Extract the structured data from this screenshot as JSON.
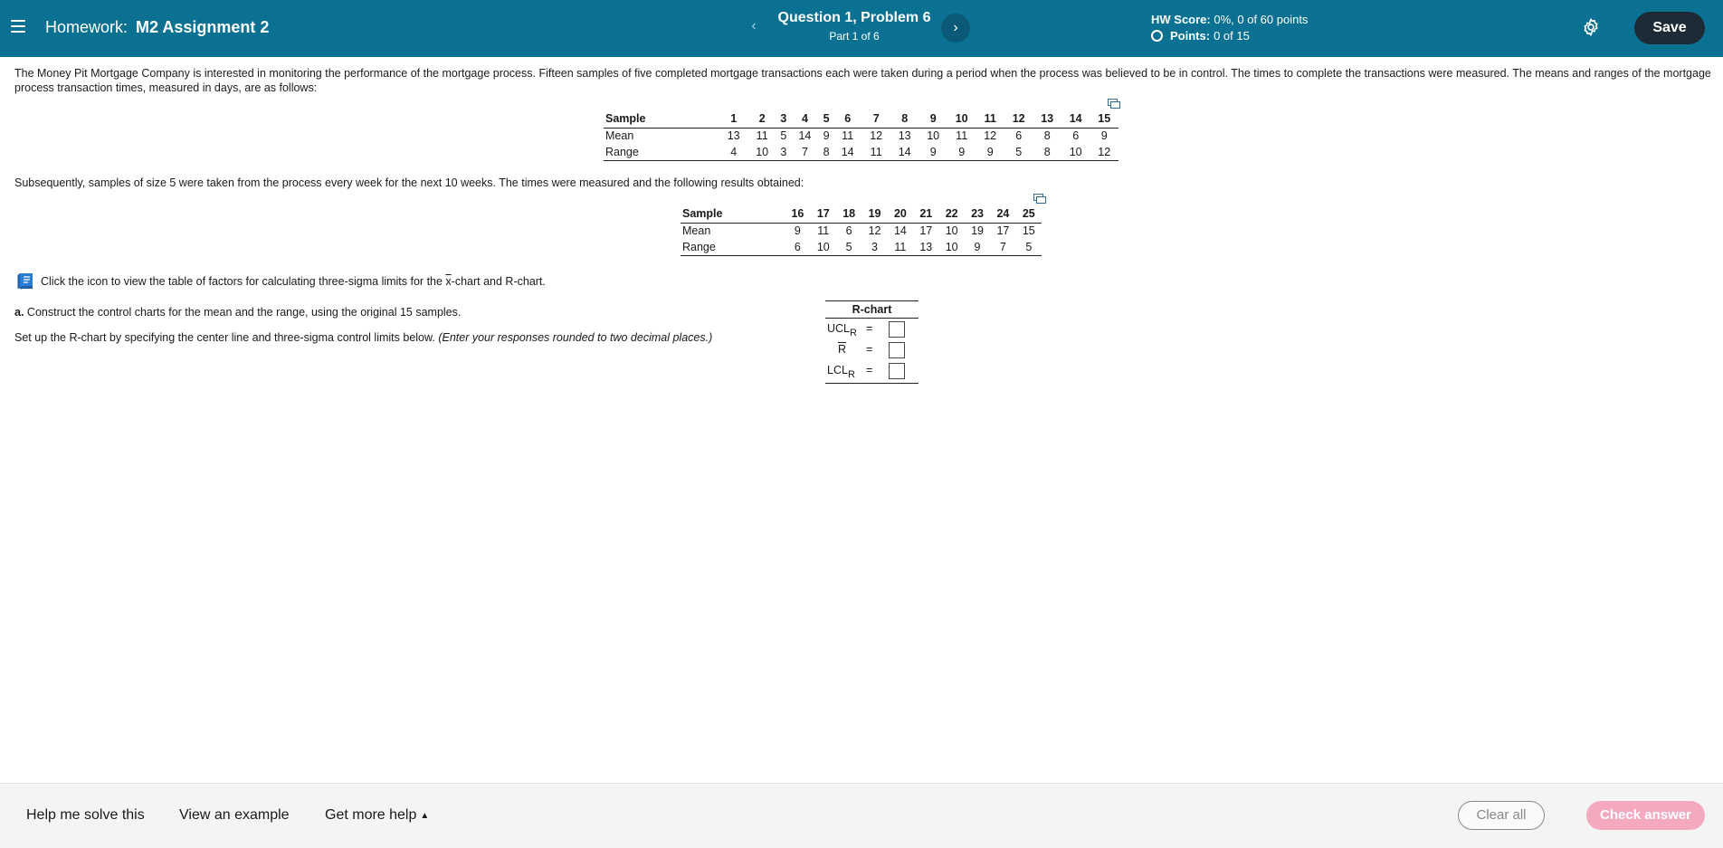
{
  "header": {
    "homework_label": "Homework:",
    "assignment_name": "M2 Assignment 2",
    "question_title": "Question 1, Problem 6",
    "part_label": "Part 1 of 6",
    "prev_symbol": "‹",
    "next_symbol": "›",
    "hw_score_label": "HW Score:",
    "hw_score_value": "0%, 0 of 60 points",
    "points_label": "Points:",
    "points_value": "0 of 15",
    "save_label": "Save",
    "bar_color": "#0b7193"
  },
  "problem": {
    "intro": "The Money Pit Mortgage Company is interested in monitoring the performance of the mortgage process. Fifteen samples of five completed mortgage transactions each were taken during a period when the process was believed to be in control. The times to complete the transactions were measured. The means and ranges of the mortgage process transaction times, measured in days, are as follows:",
    "table1": {
      "header_label": "Sample",
      "samples": [
        "1",
        "2",
        "3",
        "4",
        "5",
        "6",
        "7",
        "8",
        "9",
        "10",
        "11",
        "12",
        "13",
        "14",
        "15"
      ],
      "mean_label": "Mean",
      "means": [
        "13",
        "11",
        "5",
        "14",
        "9",
        "11",
        "12",
        "13",
        "10",
        "11",
        "12",
        "6",
        "8",
        "6",
        "9"
      ],
      "range_label": "Range",
      "ranges": [
        "4",
        "10",
        "3",
        "7",
        "8",
        "14",
        "11",
        "14",
        "9",
        "9",
        "9",
        "5",
        "8",
        "10",
        "12"
      ]
    },
    "subsequent": "Subsequently, samples of size 5 were taken from the process every week for the next 10 weeks. The times were measured and the following results obtained:",
    "table2": {
      "header_label": "Sample",
      "samples": [
        "16",
        "17",
        "18",
        "19",
        "20",
        "21",
        "22",
        "23",
        "24",
        "25"
      ],
      "mean_label": "Mean",
      "means": [
        "9",
        "11",
        "6",
        "12",
        "14",
        "17",
        "10",
        "19",
        "17",
        "15"
      ],
      "range_label": "Range",
      "ranges": [
        "6",
        "10",
        "5",
        "3",
        "11",
        "13",
        "10",
        "9",
        "7",
        "5"
      ]
    },
    "factors_text_before": "Click the icon to view the table of factors for calculating three-sigma limits for the ",
    "factors_xbar": "x",
    "factors_text_after": "-chart and R-chart.",
    "part_a_label": "a.",
    "part_a_text": "Construct the control charts for the mean and the range, using the original 15 samples.",
    "setup_text": "Set up the R-chart by specifying the center line and three-sigma control limits below.",
    "setup_hint": "(Enter your responses rounded to two decimal places.)"
  },
  "rchart": {
    "title": "R-chart",
    "ucl_main": "UCL",
    "ucl_sub": "R",
    "rbar": "R",
    "lcl_main": "LCL",
    "lcl_sub": "R",
    "equals": "="
  },
  "footer": {
    "help_solve": "Help me solve this",
    "view_example": "View an example",
    "more_help": "Get more help",
    "more_help_caret": "▲",
    "clear_all": "Clear all",
    "check_answer": "Check answer",
    "check_color": "#f5a9bf"
  }
}
